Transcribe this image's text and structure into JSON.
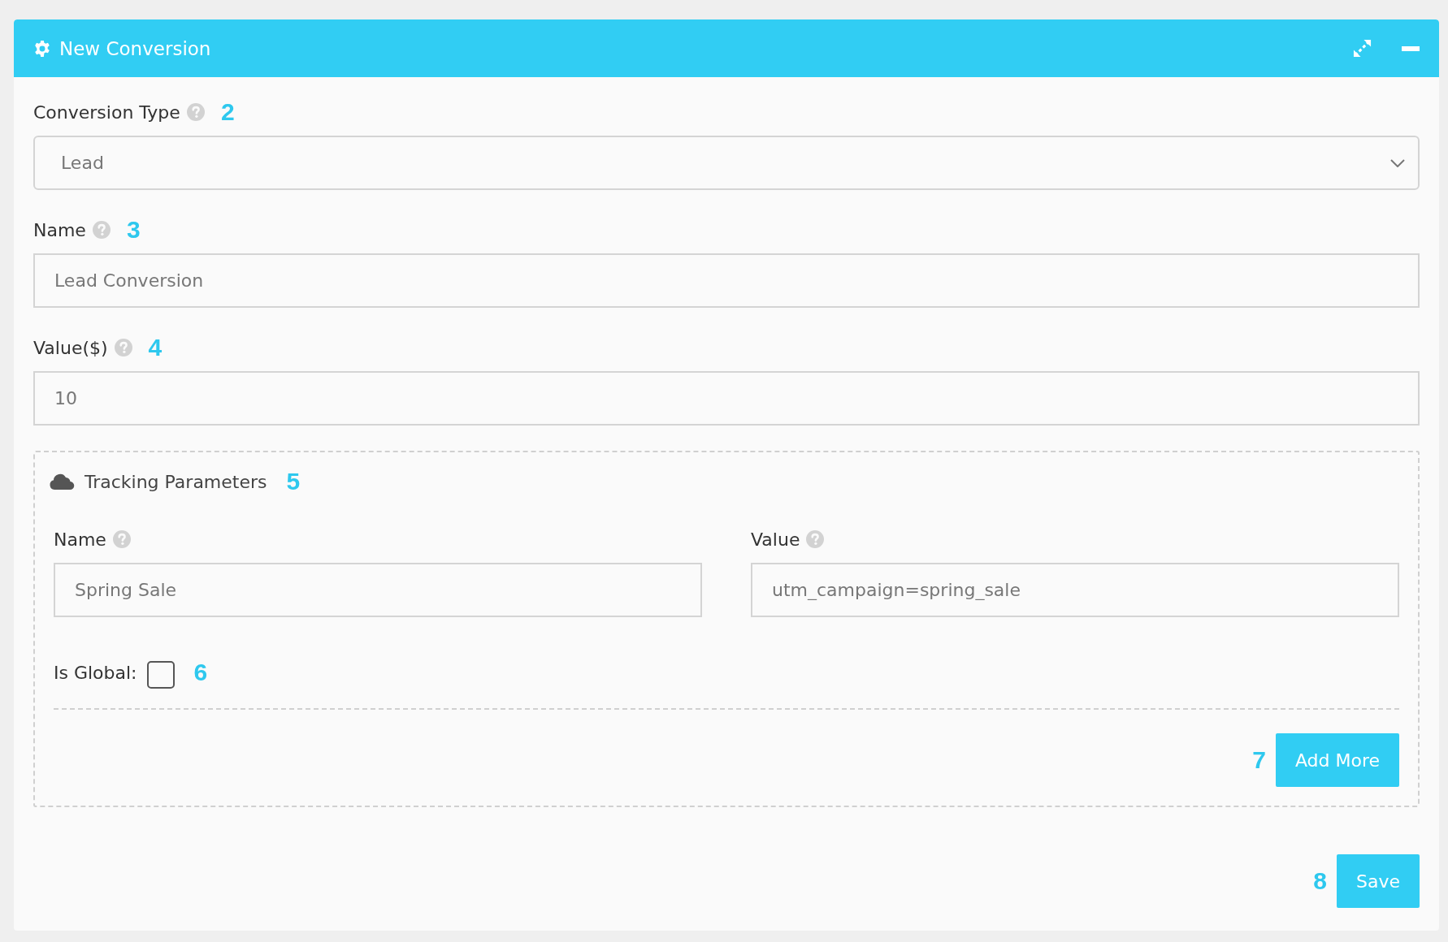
{
  "window": {
    "title": "New Conversion"
  },
  "fields": [
    {
      "label": "Conversion Type",
      "kind": "select",
      "value": "Lead",
      "marker": "2"
    },
    {
      "label": "Name",
      "kind": "text",
      "placeholder": "Lead Conversion",
      "marker": "3"
    },
    {
      "label": "Value($)",
      "kind": "text",
      "placeholder": "10",
      "marker": "4"
    }
  ],
  "tracking": {
    "title": "Tracking Parameters",
    "marker": "5",
    "fields": [
      {
        "label": "Name",
        "placeholder": "Spring Sale"
      },
      {
        "label": "Value",
        "placeholder": "utm_campaign=spring_sale"
      }
    ],
    "is_global": {
      "label": "Is Global:",
      "checked": false,
      "marker": "6"
    },
    "add_button": {
      "label": "Add More",
      "marker": "7"
    }
  },
  "save_button": {
    "label": "Save",
    "marker": "8"
  }
}
